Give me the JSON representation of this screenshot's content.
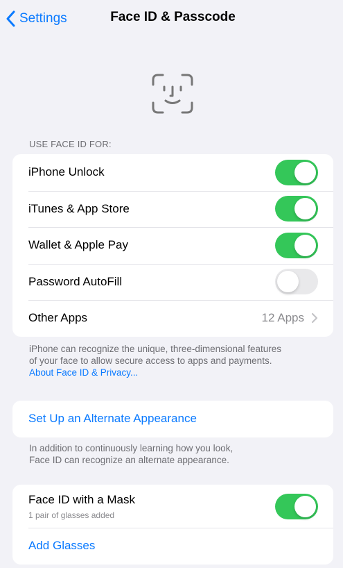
{
  "nav": {
    "back_label": "Settings",
    "title": "Face ID & Passcode"
  },
  "icons": {
    "back": "chevron-left-icon",
    "face": "face-id-icon",
    "disclosure": "chevron-right-icon"
  },
  "colors": {
    "accent": "#0a7aff",
    "toggle_on": "#34c759",
    "toggle_off": "#e9e9eb",
    "background": "#f2f2f7"
  },
  "use_face_id": {
    "header": "USE FACE ID FOR:",
    "rows": [
      {
        "label": "iPhone Unlock",
        "on": true
      },
      {
        "label": "iTunes & App Store",
        "on": true
      },
      {
        "label": "Wallet & Apple Pay",
        "on": true
      },
      {
        "label": "Password AutoFill",
        "on": false
      }
    ],
    "other_apps": {
      "label": "Other Apps",
      "value": "12 Apps"
    },
    "footer_line1": "iPhone can recognize the unique, three-dimensional features",
    "footer_line2": "of your face to allow secure access to apps and payments.",
    "footer_link": "About Face ID & Privacy..."
  },
  "alternate": {
    "button_label": "Set Up an Alternate Appearance",
    "footer_line1": "In addition to continuously learning how you look,",
    "footer_line2": "Face ID can recognize an alternate appearance."
  },
  "mask": {
    "label": "Face ID with a Mask",
    "subtext": "1 pair of glasses added",
    "on": true,
    "add_glasses": "Add Glasses"
  }
}
